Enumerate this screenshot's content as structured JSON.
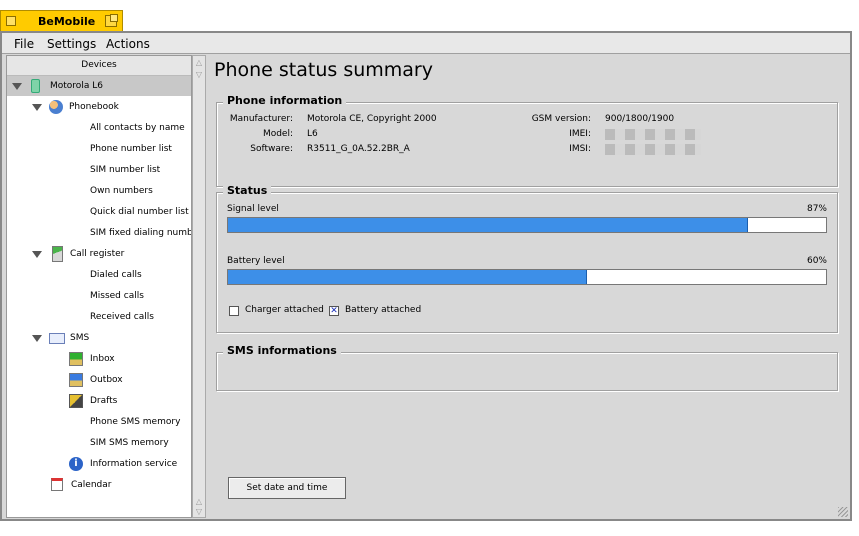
{
  "app": {
    "title": "BeMobile"
  },
  "menu": [
    "File",
    "Settings",
    "Actions"
  ],
  "sidebar": {
    "header": "Devices",
    "device": "Motorola L6",
    "phonebook": {
      "label": "Phonebook",
      "items": [
        "All contacts by name",
        "Phone number list",
        "SIM number list",
        "Own numbers",
        "Quick dial number list",
        "SIM fixed dialing number"
      ]
    },
    "call_register": {
      "label": "Call register",
      "items": [
        "Dialed calls",
        "Missed calls",
        "Received calls"
      ]
    },
    "sms": {
      "label": "SMS",
      "items": [
        "Inbox",
        "Outbox",
        "Drafts",
        "Phone SMS memory",
        "SIM SMS memory",
        "Information service"
      ]
    },
    "calendar": "Calendar"
  },
  "main": {
    "title": "Phone status summary",
    "phone_info": {
      "legend": "Phone information",
      "manufacturer_label": "Manufacturer:",
      "manufacturer": "Motorola CE, Copyright 2000",
      "model_label": "Model:",
      "model": "L6",
      "software_label": "Software:",
      "software": "R3511_G_0A.52.2BR_A",
      "gsm_label": "GSM version:",
      "gsm": "900/1800/1900",
      "imei_label": "IMEI:",
      "imsi_label": "IMSI:"
    },
    "status": {
      "legend": "Status",
      "signal_label": "Signal level",
      "signal_text": "87%",
      "signal_value": 87,
      "battery_label": "Battery level",
      "battery_text": "60%",
      "battery_value": 60,
      "charger_label": "Charger attached",
      "charger_checked": false,
      "battery_attached_label": "Battery attached",
      "battery_attached_checked": true
    },
    "sms_info": {
      "legend": "SMS informations"
    },
    "set_date_button": "Set date and time"
  },
  "colors": {
    "accent_tab": "#ffcb00",
    "bar_fill": "#3d8fe8"
  }
}
